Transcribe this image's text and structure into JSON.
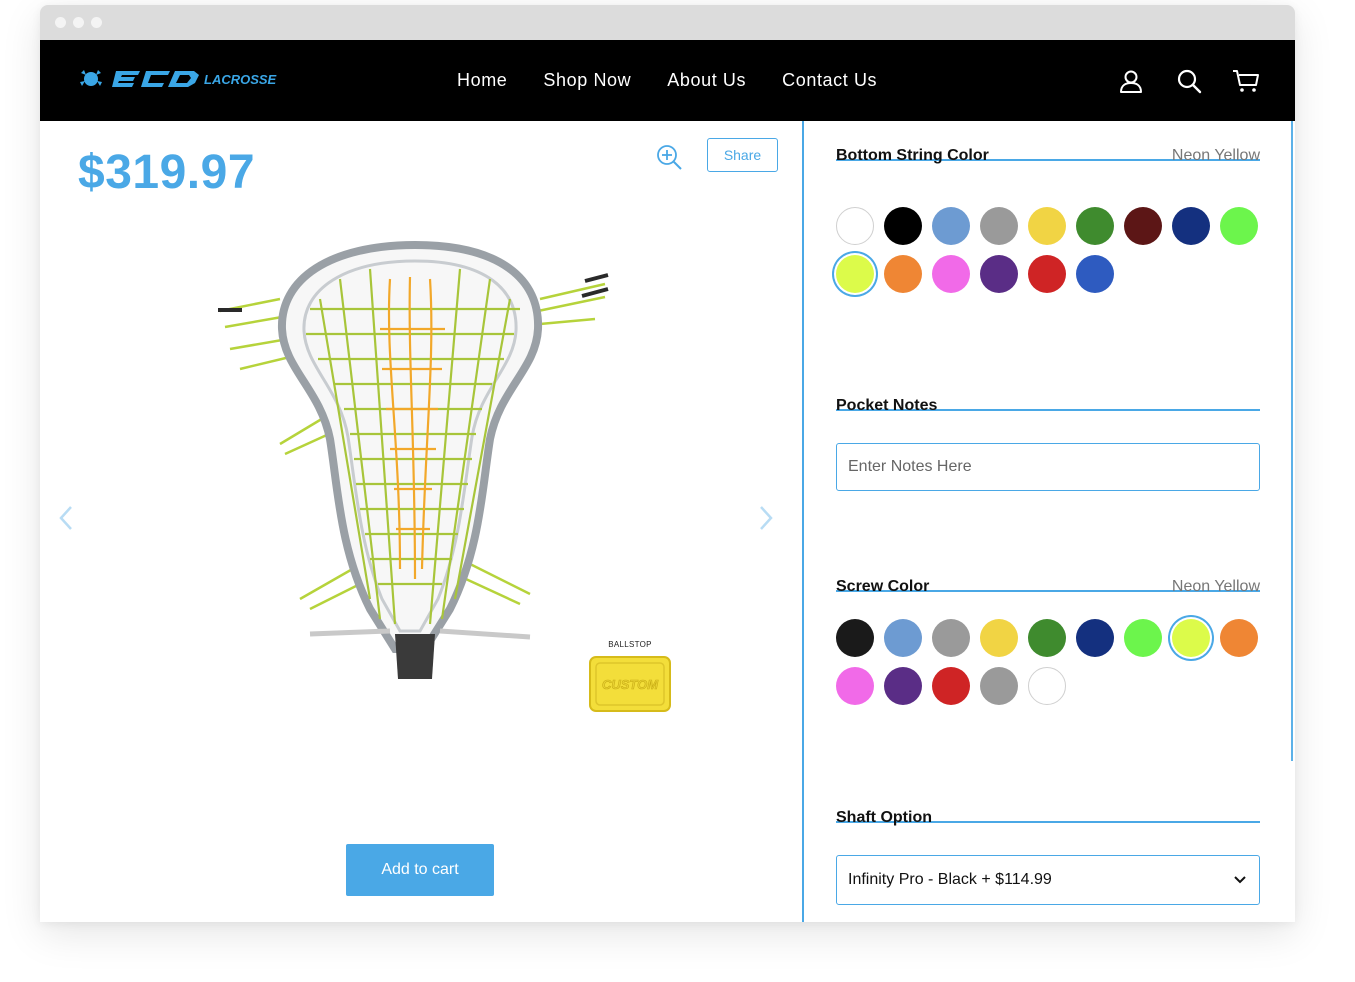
{
  "nav": {
    "logo_text": "ECD LACROSSE",
    "links": [
      "Home",
      "Shop Now",
      "About Us",
      "Contact Us"
    ]
  },
  "product": {
    "price": "$319.97",
    "share_label": "Share",
    "ballstop_label": "BALLSTOP",
    "ballstop_text": "CUSTOM",
    "add_to_cart_label": "Add to cart"
  },
  "bottom_string": {
    "title": "Bottom String Color",
    "selected": "Neon Yellow",
    "colors": [
      "#ffffff",
      "#000000",
      "#6d9bd2",
      "#9a9a9a",
      "#f1d444",
      "#3f8b2e",
      "#5c1616",
      "#14307f",
      "#6cf54c",
      "#dcfb4a",
      "#ef8634",
      "#f16ae8",
      "#5a2d86",
      "#cf2425",
      "#2e5bc0"
    ],
    "selected_index": 9
  },
  "pocket_notes": {
    "title": "Pocket Notes",
    "placeholder": "Enter Notes Here"
  },
  "screw_color": {
    "title": "Screw Color",
    "selected": "Neon Yellow",
    "colors": [
      "#1a1a1a",
      "#6d9bd2",
      "#9a9a9a",
      "#f1d444",
      "#3f8b2e",
      "#14307f",
      "#6cf54c",
      "#dcfb4a",
      "#ef8634",
      "#f16ae8",
      "#5a2d86",
      "#cf2425",
      "#9a9a9a",
      "#ffffff"
    ],
    "selected_index": 7
  },
  "shaft_option": {
    "title": "Shaft Option",
    "selected": "Infinity Pro - Black + $114.99"
  },
  "colors": {
    "accent": "#4aa8e6",
    "navbar": "#000000"
  }
}
